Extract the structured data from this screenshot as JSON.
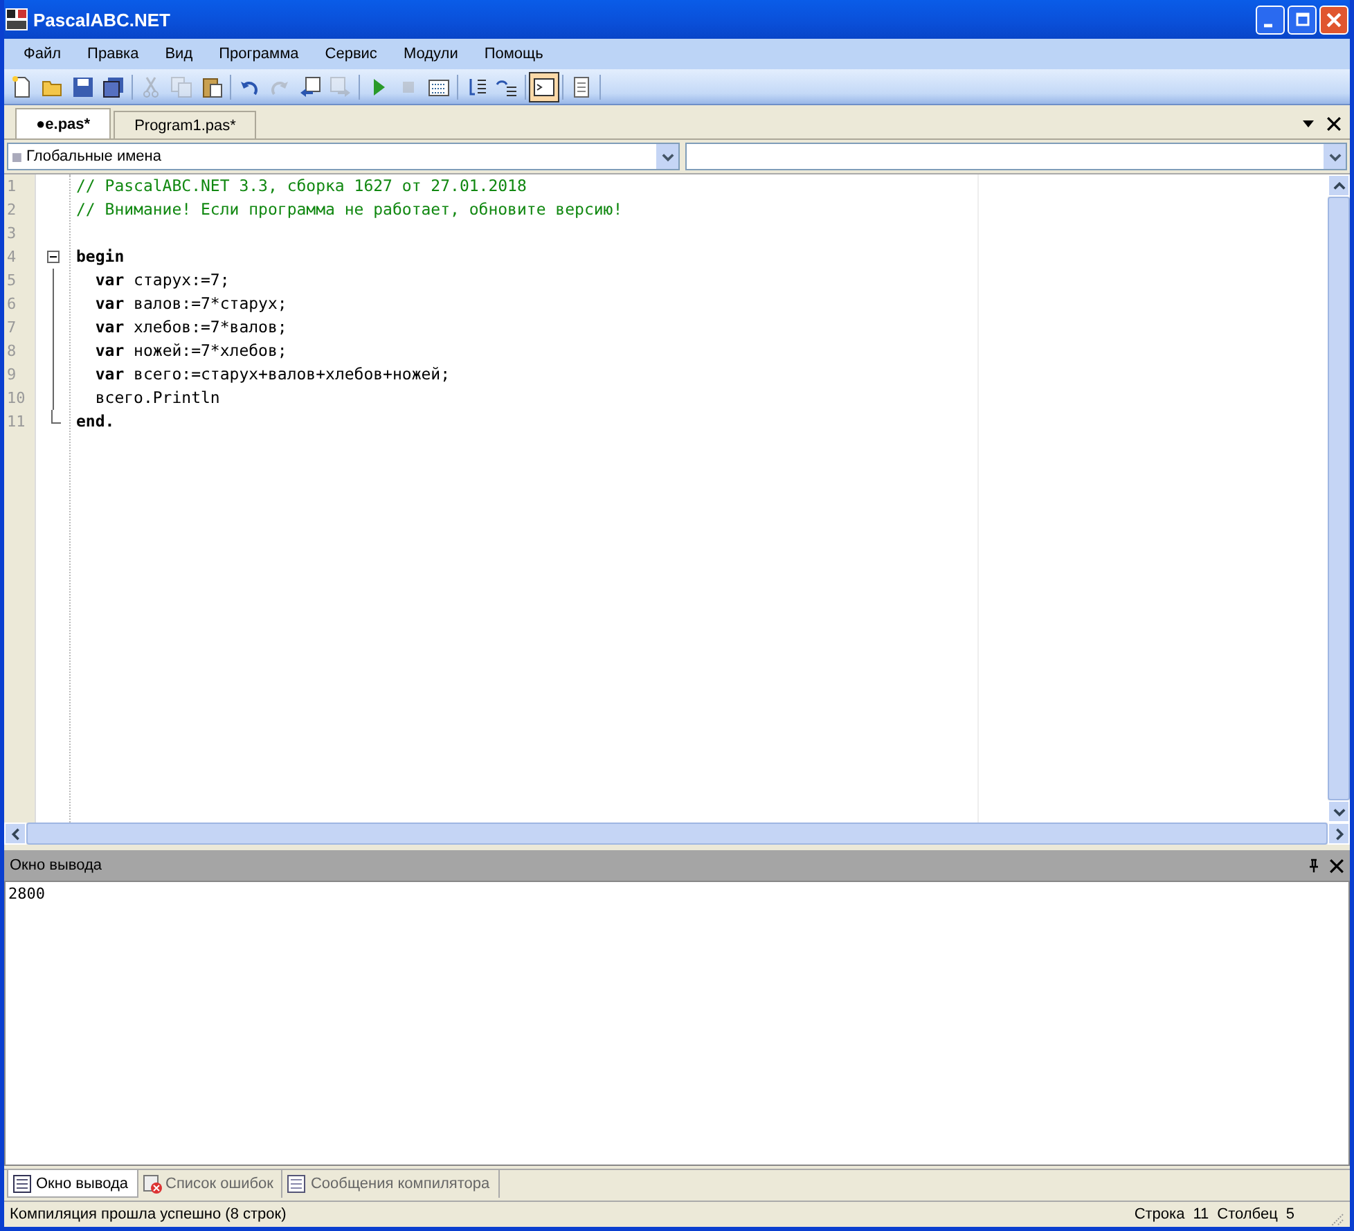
{
  "window": {
    "title": "PascalABC.NET"
  },
  "menu": [
    "Файл",
    "Правка",
    "Вид",
    "Программа",
    "Сервис",
    "Модули",
    "Помощь"
  ],
  "toolbar": [
    {
      "kind": "new",
      "disabled": false,
      "selected": false
    },
    {
      "kind": "open",
      "disabled": false,
      "selected": false
    },
    {
      "kind": "save",
      "disabled": false,
      "selected": false
    },
    {
      "kind": "save-all",
      "disabled": false,
      "selected": false
    },
    {
      "kind": "separator"
    },
    {
      "kind": "cut",
      "disabled": true,
      "selected": false
    },
    {
      "kind": "copy",
      "disabled": true,
      "selected": false
    },
    {
      "kind": "paste",
      "disabled": false,
      "selected": false
    },
    {
      "kind": "separator"
    },
    {
      "kind": "undo",
      "disabled": false,
      "selected": false
    },
    {
      "kind": "redo",
      "disabled": true,
      "selected": false
    },
    {
      "kind": "back",
      "disabled": false,
      "selected": false
    },
    {
      "kind": "forward",
      "disabled": true,
      "selected": false
    },
    {
      "kind": "separator"
    },
    {
      "kind": "run",
      "disabled": false,
      "selected": false
    },
    {
      "kind": "stop",
      "disabled": true,
      "selected": false
    },
    {
      "kind": "compile",
      "disabled": false,
      "selected": false
    },
    {
      "kind": "separator"
    },
    {
      "kind": "step-into",
      "disabled": false,
      "selected": false
    },
    {
      "kind": "step-over",
      "disabled": false,
      "selected": false
    },
    {
      "kind": "separator"
    },
    {
      "kind": "console",
      "disabled": false,
      "selected": true
    },
    {
      "kind": "separator"
    },
    {
      "kind": "document",
      "disabled": false,
      "selected": false
    },
    {
      "kind": "separator"
    }
  ],
  "tabs": [
    {
      "label": "●e.pas*",
      "selected": true
    },
    {
      "label": "Program1.pas*",
      "selected": false
    }
  ],
  "scope_combo": {
    "value": "Глобальные имена"
  },
  "code_lines": [
    {
      "number": "1",
      "tokens": [
        {
          "kind": "comment",
          "text": "// PascalABC.NET 3.3, сборка 1627 от 27.01.2018"
        }
      ]
    },
    {
      "number": "2",
      "tokens": [
        {
          "kind": "comment",
          "text": "// Внимание! Если программа не работает, обновите версию!"
        }
      ]
    },
    {
      "number": "3"
    },
    {
      "number": "4",
      "expanded": true,
      "tokens": [
        {
          "kind": "keyword",
          "text": "begin"
        }
      ]
    },
    {
      "number": "5",
      "tokens": [
        {
          "kind": "keyword",
          "text": "  var"
        },
        {
          "kind": "plain",
          "text": " старух:=7;"
        }
      ]
    },
    {
      "number": "6",
      "tokens": [
        {
          "kind": "keyword",
          "text": "  var"
        },
        {
          "kind": "plain",
          "text": " валов:=7*старух;"
        }
      ]
    },
    {
      "number": "7",
      "tokens": [
        {
          "kind": "keyword",
          "text": "  var"
        },
        {
          "kind": "plain",
          "text": " хлебов:=7*валов;"
        }
      ]
    },
    {
      "number": "8",
      "tokens": [
        {
          "kind": "keyword",
          "text": "  var"
        },
        {
          "kind": "plain",
          "text": " ножей:=7*хлебов;"
        }
      ]
    },
    {
      "number": "9",
      "tokens": [
        {
          "kind": "keyword",
          "text": "  var"
        },
        {
          "kind": "plain",
          "text": " всего:=старух+валов+хлебов+ножей;"
        }
      ]
    },
    {
      "number": "10",
      "tokens": [
        {
          "kind": "plain",
          "text": "  всего.Println"
        }
      ]
    },
    {
      "number": "11",
      "tokens": [
        {
          "kind": "keyword",
          "text": "end."
        }
      ]
    }
  ],
  "output_panel": {
    "title": "Окно вывода",
    "text": "2800"
  },
  "bottom_tabs": [
    {
      "label": "Окно вывода",
      "kind": "output",
      "selected": true
    },
    {
      "label": "Список ошибок",
      "kind": "errors",
      "selected": false
    },
    {
      "label": "Сообщения компилятора",
      "kind": "messages",
      "selected": false
    }
  ],
  "status_bar": {
    "message": "Компиляция прошла успешно (8 строк)",
    "line_label": "Строка",
    "line": "11",
    "column_label": "Столбец",
    "column": "5"
  }
}
